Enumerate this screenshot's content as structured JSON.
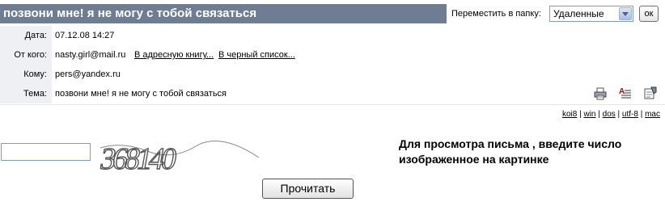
{
  "message": {
    "subject_title": "позвони мне! я не могу с тобой связаться"
  },
  "toolbar": {
    "move_to_folder_label": "Переместить в папку:",
    "folder_selected": "Удаленные",
    "ok_label": "ок"
  },
  "headers": [
    {
      "label": "Дата:",
      "value": "07.12.08 14:27"
    },
    {
      "label": "От кого:",
      "value": "nasty.girl@mail.ru"
    },
    {
      "label": "Кому:",
      "value": "pers@yandex.ru"
    },
    {
      "label": "Тема:",
      "value": "позвони мне! я не могу с тобой связаться"
    }
  ],
  "from_links": {
    "address_book": "В адресную книгу...",
    "black_list": "В черный список..."
  },
  "icons": [
    "print-icon",
    "spellcheck-icon",
    "properties-icon"
  ],
  "encodings": [
    "koi8",
    "win",
    "dos",
    "utf-8",
    "mac"
  ],
  "captcha": {
    "instruction": "Для просмотра письма , введите число изображенное на картинке",
    "image_text": "368140",
    "read_button": "Прочитать"
  }
}
